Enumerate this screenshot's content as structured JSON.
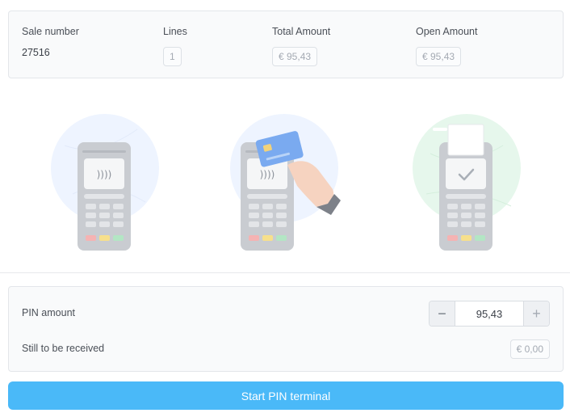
{
  "summary": {
    "sale_number_label": "Sale number",
    "sale_number_value": "27516",
    "lines_label": "Lines",
    "lines_value": "1",
    "total_amount_label": "Total Amount",
    "total_amount_value": "€ 95,43",
    "open_amount_label": "Open Amount",
    "open_amount_value": "€ 95,43"
  },
  "illustrations": [
    {
      "icon": "contactless-terminal-icon",
      "circle_color": "#eef4ff"
    },
    {
      "icon": "card-tap-terminal-icon",
      "circle_color": "#eef4ff"
    },
    {
      "icon": "payment-success-terminal-icon",
      "circle_color": "#e6f7ec"
    }
  ],
  "pin": {
    "amount_label": "PIN amount",
    "amount_value": "95,43",
    "minus_symbol": "−",
    "plus_symbol": "+",
    "still_label": "Still to be received",
    "still_value": "€ 0,00"
  },
  "actions": {
    "start_label": "Start PIN terminal"
  },
  "colors": {
    "primary": "#4ab9f8",
    "success_circle": "#e6f7ec",
    "info_circle": "#eef4ff"
  }
}
